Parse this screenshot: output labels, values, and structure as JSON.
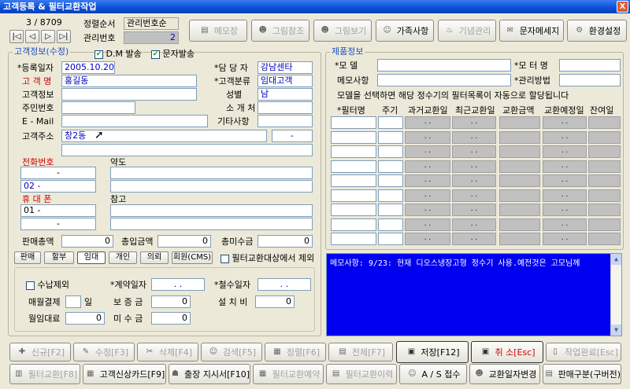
{
  "window": {
    "title": "고객등록 & 필터교환작업",
    "close": "X"
  },
  "nav": {
    "record": "3 / 8709",
    "sort_label": "정렬순서",
    "sort_value": "관리번호순",
    "mgmt_label": "관리번호",
    "mgmt_value": "2"
  },
  "toolbar": [
    "메모장",
    "그림참조",
    "그림보기",
    "가족사항",
    "기념관리",
    "문자메세지",
    "환경설정"
  ],
  "customer": {
    "section_title": "고객정보(수정)",
    "dm_label": "D.M 발송",
    "sms_label": "문자발송",
    "reg_date_label": "*등록일자",
    "reg_date": "2005.10.20",
    "name_label": "고 객 명",
    "name": "홍길동",
    "info_label": "고객정보",
    "id_label": "주민번호",
    "email_label": "E - Mail",
    "addr_label": "고객주소",
    "addr": "창2동",
    "addr_zip": "-",
    "manager_label": "*담 당 자",
    "manager": "강남센타",
    "category_label": "*고객분류",
    "category": "임대고객",
    "gender_label": "성별",
    "gender": "남",
    "referrer_label": "소 개 처",
    "other_label": "기타사항",
    "phone_label": "전화번호",
    "phone1": "-",
    "phone2": "02  -",
    "mobile_label": "휴 대 폰",
    "mobile1": "01  -",
    "mobile2": "-",
    "map_label": "약도",
    "note_label": "참고",
    "sales_total_label": "판매총액",
    "sales_total": "0",
    "paid_total_label": "총입금액",
    "paid_total": "0",
    "unpaid_label": "총미수금",
    "unpaid": "0"
  },
  "tabs": [
    "판매",
    "할부",
    "임대",
    "개인",
    "의뢰",
    "회원(CMS)"
  ],
  "filter_exclude_label": "필터교환대상에서 제외",
  "rental": {
    "exclude_label": "수납제외",
    "contract_label": "*계약일자",
    "contract": ". .",
    "withdraw_label": "*철수일자",
    "withdraw": ". .",
    "monthly_label": "매월결제",
    "monthly_unit": "일",
    "deposit_label": "보 증 금",
    "deposit": "0",
    "install_label": "설 치 비",
    "install": "0",
    "monthly_fee_label": "월임대료",
    "monthly_fee": "0",
    "receivable_label": "미 수 금",
    "receivable": "0"
  },
  "product": {
    "section_title": "제품정보",
    "model_label": "*모    델",
    "motor_label": "*모 터 명",
    "memo_label": "메모사항",
    "manage_label": "*관리방법",
    "notice": "모델을 선택하면 해당 정수기의 필터목록이 자동으로 할당됩니다",
    "columns": [
      "*필터명",
      "주기",
      "과거교환일",
      "최근교환일",
      "교환금액",
      "교환예정일",
      "잔여일"
    ],
    "date_placeholder": ". ."
  },
  "memo_text": "메모사항: 9/23: 현재 디오스냉장고형 정수기 사용.예전것은 고모님께",
  "bottom_row1": [
    "신규[F2]",
    "수정[F3]",
    "삭제[F4]",
    "검색[F5]",
    "정렬[F6]",
    "전체[F7]",
    "저장[F12]",
    "취 소[Esc]",
    "작업완료[Esc]"
  ],
  "bottom_row2": [
    "필터교환[F8]",
    "고객신상카드[F9]",
    "출장 지시서[F10]",
    "필터교환예약",
    "필터교환이력",
    "A / S 접수",
    "교환일자변경",
    "판매구분(구버전)"
  ],
  "colors": {
    "accent": "#1e4fc0",
    "memo_bg": "#0000f0",
    "red_label": "#d00000"
  }
}
